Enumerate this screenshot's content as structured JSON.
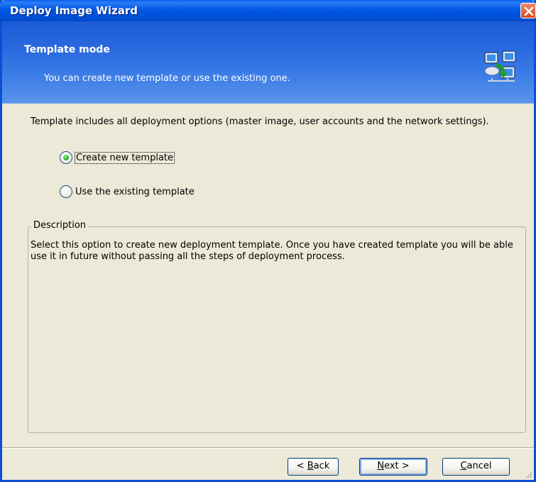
{
  "window": {
    "title": "Deploy Image Wizard"
  },
  "banner": {
    "heading": "Template mode",
    "subheading": "You can create new template or use the existing one.",
    "icon": "network-computers-icon"
  },
  "content": {
    "intro": "Template includes all deployment options (master image, user accounts and the network settings).",
    "options": [
      {
        "label": "Create new template",
        "selected": true
      },
      {
        "label": "Use the existing template",
        "selected": false
      }
    ],
    "description": {
      "legend": "Description",
      "text": "Select this option to create new deployment template. Once you have created template you will be able use it in future without passing all the steps of deployment process."
    }
  },
  "buttons": {
    "back": {
      "prefix": "< ",
      "accel": "B",
      "rest": "ack"
    },
    "next": {
      "accel": "N",
      "rest": "ext >"
    },
    "cancel": {
      "accel": "C",
      "rest": "ancel"
    }
  },
  "colors": {
    "titlebar": "#0058e6",
    "banner": "#2a6ae0",
    "dialog_bg": "#ece9d8",
    "close_button": "#d94a22"
  }
}
